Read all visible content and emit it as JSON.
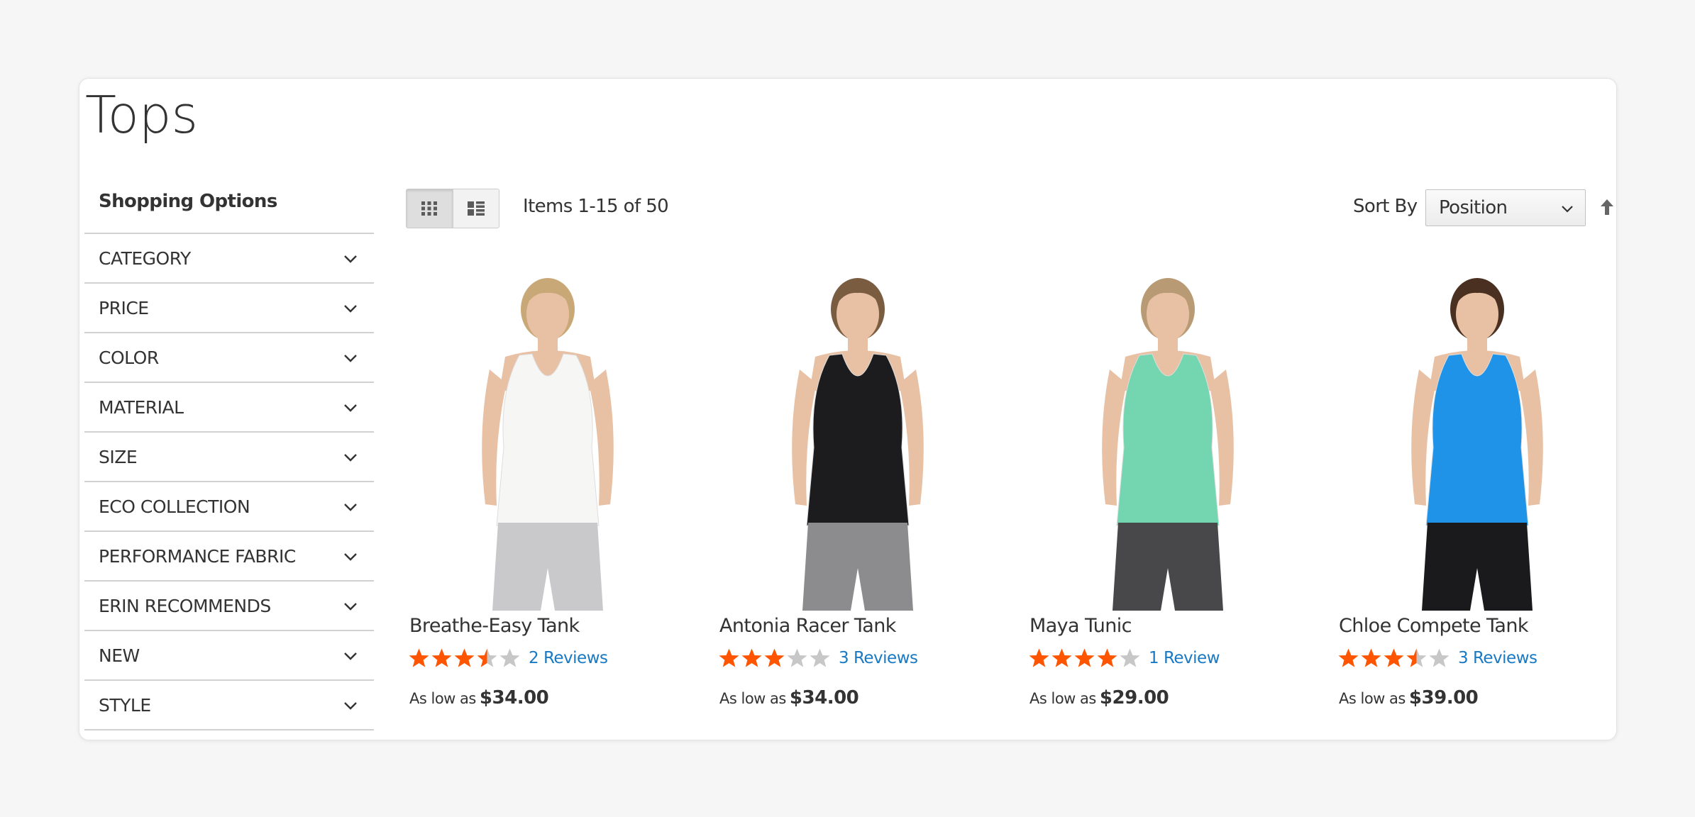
{
  "page": {
    "title": "Tops"
  },
  "sidebar": {
    "title": "Shopping Options",
    "filters": [
      {
        "label": "CATEGORY",
        "icon": "chevron-down-icon"
      },
      {
        "label": "PRICE",
        "icon": "chevron-down-icon"
      },
      {
        "label": "COLOR",
        "icon": "chevron-down-icon"
      },
      {
        "label": "MATERIAL",
        "icon": "chevron-down-icon"
      },
      {
        "label": "SIZE",
        "icon": "chevron-down-icon"
      },
      {
        "label": "ECO COLLECTION",
        "icon": "chevron-down-icon"
      },
      {
        "label": "PERFORMANCE FABRIC",
        "icon": "chevron-down-icon"
      },
      {
        "label": "ERIN RECOMMENDS",
        "icon": "chevron-down-icon"
      },
      {
        "label": "NEW",
        "icon": "chevron-down-icon"
      },
      {
        "label": "STYLE",
        "icon": "chevron-down-icon"
      }
    ]
  },
  "toolbar": {
    "view_modes": [
      {
        "icon": "grid-view-icon",
        "active": true
      },
      {
        "icon": "list-view-icon",
        "active": false
      }
    ],
    "amount": "Items 1-15 of 50",
    "sort_label": "Sort By",
    "sort_value": "Position",
    "sort_direction_icon": "arrow-up-icon"
  },
  "products": [
    {
      "name": "Breathe-Easy Tank",
      "rating": 3.5,
      "reviews": "2 Reviews",
      "price_label": "As low as",
      "price": "$34.00",
      "top_color": "#f6f6f4",
      "bottom_color": "#c9c9cc",
      "hair_color": "#c9a878"
    },
    {
      "name": "Antonia Racer Tank",
      "rating": 3,
      "reviews": "3 Reviews",
      "price_label": "As low as",
      "price": "$34.00",
      "top_color": "#1c1c1e",
      "bottom_color": "#8c8c8e",
      "hair_color": "#7a5c40"
    },
    {
      "name": "Maya Tunic",
      "rating": 4,
      "reviews": "1 Review",
      "price_label": "As low as",
      "price": "$29.00",
      "top_color": "#74d6b0",
      "bottom_color": "#48484a",
      "hair_color": "#b89a74"
    },
    {
      "name": "Chloe Compete Tank",
      "rating": 3.5,
      "reviews": "3 Reviews",
      "price_label": "As low as",
      "price": "$39.00",
      "top_color": "#1e93e8",
      "bottom_color": "#1a1a1c",
      "hair_color": "#4a3020"
    }
  ],
  "colors": {
    "star_filled": "#ff5501",
    "star_empty": "#c7c7c7",
    "link": "#1979c3",
    "skin": "#e8c1a4"
  }
}
